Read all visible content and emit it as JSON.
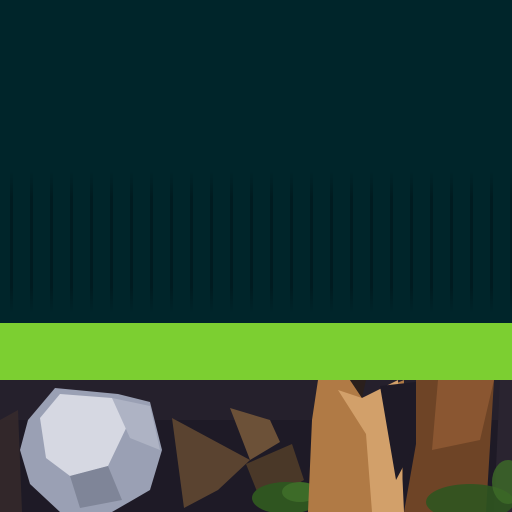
{
  "scene": {
    "colors": {
      "sky": "#00252a",
      "stripe": "#001216",
      "grass_band": "#7ccf31",
      "ground_dark": "#1e1a26",
      "rock": "#c9ccd8",
      "wood_light": "#b07a45",
      "wood_dark": "#6e4426",
      "foliage": "#3d6b28"
    },
    "objects": [
      "rock-icon",
      "tree-trunk-icon",
      "tent-icon",
      "bush-icon"
    ]
  }
}
